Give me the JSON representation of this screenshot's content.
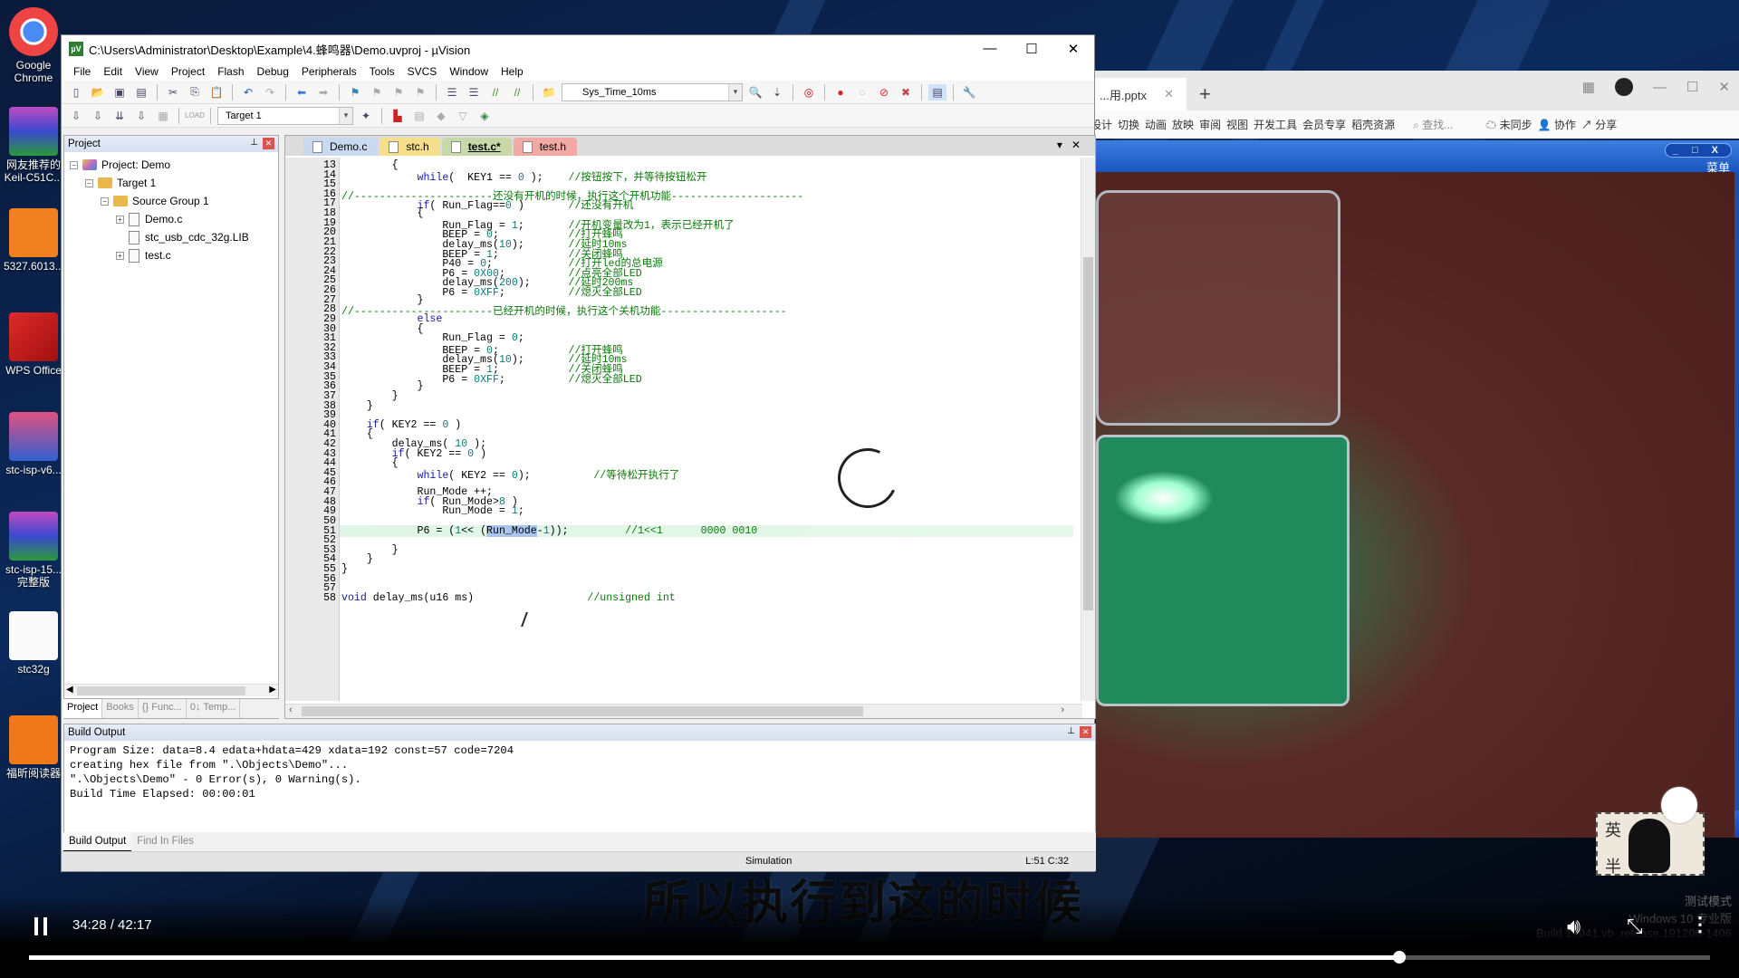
{
  "desktop": {
    "icons": [
      {
        "label": "Google Chrome",
        "icon": "chrome-icon"
      },
      {
        "label": "网友推荐的 Keil-C51C...",
        "icon": "winrar-archive-icon"
      },
      {
        "label": "5327.6013...",
        "icon": "pdf-file-icon"
      },
      {
        "label": "WPS Office",
        "icon": "wps-icon"
      },
      {
        "label": "stc-isp-v6...",
        "icon": "stc-isp-icon"
      },
      {
        "label": "stc-isp-15... 完整版",
        "icon": "winrar-archive-icon"
      },
      {
        "label": "stc32g",
        "icon": "pdf-doc-icon"
      },
      {
        "label": "福昕阅读器",
        "icon": "foxit-pdf-icon"
      }
    ]
  },
  "wps": {
    "tab_label": "...用.pptx",
    "ribbon": [
      "设计",
      "切换",
      "动画",
      "放映",
      "审阅",
      "视图",
      "开发工具",
      "会员专享",
      "稻壳资源"
    ],
    "search_placeholder": "查找...",
    "sync": "未同步",
    "collab": "协作",
    "share": "分享"
  },
  "player_window": {
    "menu_label": "菜单",
    "buttons": "_ □ X"
  },
  "uvision": {
    "title": "C:\\Users\\Administrator\\Desktop\\Example\\4.蜂鸣器\\Demo.uvproj - µVision",
    "menu": [
      "File",
      "Edit",
      "View",
      "Project",
      "Flash",
      "Debug",
      "Peripherals",
      "Tools",
      "SVCS",
      "Window",
      "Help"
    ],
    "toolbar": {
      "function_combo": "Sys_Time_10ms",
      "target_combo": "Target 1"
    },
    "project_pane": {
      "title": "Project",
      "tree": [
        {
          "label": "Project: Demo",
          "level": 0,
          "type": "project",
          "expander": "−"
        },
        {
          "label": "Target 1",
          "level": 1,
          "type": "folder",
          "expander": "−"
        },
        {
          "label": "Source Group 1",
          "level": 2,
          "type": "folder",
          "expander": "−"
        },
        {
          "label": "Demo.c",
          "level": 3,
          "type": "file",
          "expander": "+"
        },
        {
          "label": "stc_usb_cdc_32g.LIB",
          "level": 3,
          "type": "file",
          "expander": ""
        },
        {
          "label": "test.c",
          "level": 3,
          "type": "file",
          "expander": "+"
        }
      ],
      "tabs": [
        "Project",
        "Books",
        "{} Func...",
        "0↓ Temp..."
      ]
    },
    "editor": {
      "tabs": [
        {
          "label": "Demo.c",
          "color": "#c9d9ef"
        },
        {
          "label": "stc.h",
          "color": "#f5df8a"
        },
        {
          "label": "test.c*",
          "color": "#c7d9a8",
          "active": true
        },
        {
          "label": "test.h",
          "color": "#f2a9a4"
        }
      ],
      "lines": [
        {
          "n": "13",
          "code": "        {",
          "comment": ""
        },
        {
          "n": "14",
          "code": "            while(  KEY1 == 0 );",
          "comment": "//按钮按下，并等待按钮松开"
        },
        {
          "n": "15",
          "code": "",
          "comment": ""
        },
        {
          "n": "16",
          "code": "",
          "comment": "//----------------------还没有开机的时候，执行这个开机功能---------------------"
        },
        {
          "n": "17",
          "code": "            if( Run_Flag==0 )",
          "comment": "//还没有开机"
        },
        {
          "n": "18",
          "code": "            {",
          "comment": ""
        },
        {
          "n": "19",
          "code": "                Run_Flag = 1;",
          "comment": "//开机变量改为1，表示已经开机了"
        },
        {
          "n": "20",
          "code": "                BEEP = 0;",
          "comment": "//打开蜂鸣"
        },
        {
          "n": "21",
          "code": "                delay_ms(10);",
          "comment": "//延时10ms"
        },
        {
          "n": "22",
          "code": "                BEEP = 1;",
          "comment": "//关闭蜂鸣"
        },
        {
          "n": "23",
          "code": "                P40 = 0;",
          "comment": "//打开led的总电源"
        },
        {
          "n": "24",
          "code": "                P6 = 0X00;",
          "comment": "//点亮全部LED"
        },
        {
          "n": "25",
          "code": "                delay_ms(200);",
          "comment": "//延时200ms"
        },
        {
          "n": "26",
          "code": "                P6 = 0XFF;",
          "comment": "//熄灭全部LED"
        },
        {
          "n": "27",
          "code": "            }",
          "comment": ""
        },
        {
          "n": "28",
          "code": "",
          "comment": "//----------------------已经开机的时候，执行这个关机功能--------------------"
        },
        {
          "n": "29",
          "code": "            else",
          "comment": ""
        },
        {
          "n": "30",
          "code": "            {",
          "comment": ""
        },
        {
          "n": "31",
          "code": "                Run_Flag = 0;",
          "comment": ""
        },
        {
          "n": "32",
          "code": "                BEEP = 0;",
          "comment": "//打开蜂鸣"
        },
        {
          "n": "33",
          "code": "                delay_ms(10);",
          "comment": "//延时10ms"
        },
        {
          "n": "34",
          "code": "                BEEP = 1;",
          "comment": "//关闭蜂鸣"
        },
        {
          "n": "35",
          "code": "                P6 = 0XFF;",
          "comment": "//熄灭全部LED"
        },
        {
          "n": "36",
          "code": "            }",
          "comment": ""
        },
        {
          "n": "37",
          "code": "        }",
          "comment": ""
        },
        {
          "n": "38",
          "code": "    }",
          "comment": ""
        },
        {
          "n": "39",
          "code": "",
          "comment": ""
        },
        {
          "n": "40",
          "code": "    if( KEY2 == 0 )",
          "comment": ""
        },
        {
          "n": "41",
          "code": "    {",
          "comment": ""
        },
        {
          "n": "42",
          "code": "        delay_ms( 10 );",
          "comment": ""
        },
        {
          "n": "43",
          "code": "        if( KEY2 == 0 )",
          "comment": ""
        },
        {
          "n": "44",
          "code": "        {",
          "comment": ""
        },
        {
          "n": "45",
          "code": "            while( KEY2 == 0);",
          "comment": "    //等待松开执行了"
        },
        {
          "n": "46",
          "code": "",
          "comment": ""
        },
        {
          "n": "47",
          "code": "            Run_Mode ++;",
          "comment": ""
        },
        {
          "n": "48",
          "code": "            if( Run_Mode>8 )",
          "comment": ""
        },
        {
          "n": "49",
          "code": "                Run_Mode = 1;",
          "comment": ""
        },
        {
          "n": "50",
          "code": "",
          "comment": ""
        },
        {
          "n": "51",
          "code": "            P6 = (1<< (Run_Mode-1));",
          "comment": "        //1<<1      0000 0010",
          "highlight": true
        },
        {
          "n": "52",
          "code": "",
          "comment": ""
        },
        {
          "n": "53",
          "code": "        }",
          "comment": ""
        },
        {
          "n": "54",
          "code": "    }",
          "comment": ""
        },
        {
          "n": "55",
          "code": "}",
          "comment": ""
        },
        {
          "n": "56",
          "code": "",
          "comment": ""
        },
        {
          "n": "57",
          "code": "",
          "comment": ""
        },
        {
          "n": "58",
          "code": "void delay_ms(u16 ms)",
          "comment": "   //unsigned int"
        }
      ],
      "selected_text": "Run_Mode"
    },
    "build_output": {
      "title": "Build Output",
      "lines": [
        "Program Size: data=8.4 edata+hdata=429 xdata=192 const=57 code=7204",
        "creating hex file from \".\\Objects\\Demo\"...",
        "\".\\Objects\\Demo\" - 0 Error(s), 0 Warning(s).",
        "Build Time Elapsed:  00:00:01"
      ],
      "tabs": [
        "Build Output",
        "Find In Files"
      ]
    },
    "status": {
      "mode": "Simulation",
      "position": "L:51 C:32"
    }
  },
  "video": {
    "subtitle": "所以执行到这的时候",
    "time": "34:28 / 42:17",
    "progress": 0.8154,
    "watermark": [
      "测试模式",
      "Windows 10 专业版",
      "Build 19041.vb_release.191206-1406"
    ]
  },
  "sticker": {
    "text1": "英",
    "text2": "半"
  }
}
